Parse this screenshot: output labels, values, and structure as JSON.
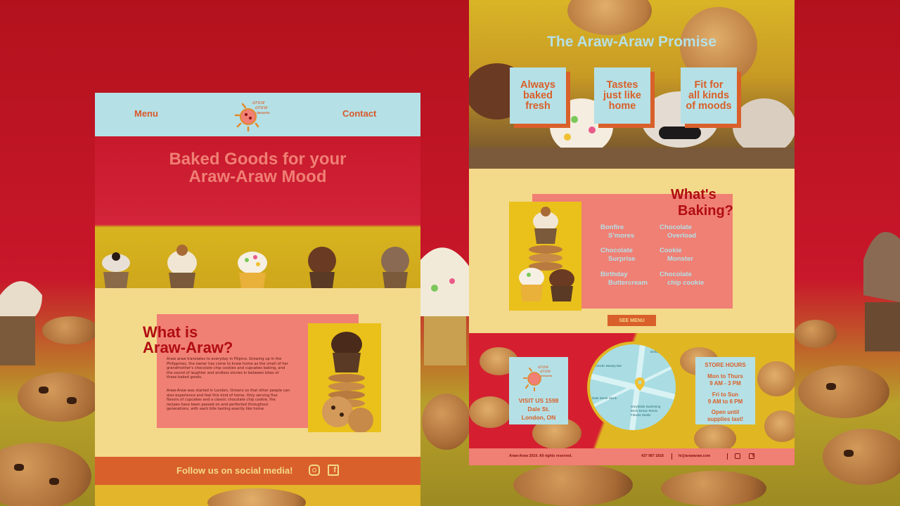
{
  "left_page": {
    "nav": {
      "menu": "Menu",
      "contact": "Contact",
      "logo_text": "araw araw desserts"
    },
    "hero_title": [
      "Baked Goods for your",
      "Araw-Araw Mood"
    ],
    "about": {
      "title": [
        "What is",
        "Araw-Araw?"
      ],
      "paragraph1": "Araw araw translates to everyday in Filipino. Growing up in the Philippines, the owner has come to know home as the smell of her grandmother's chocolate chip cookies and cupcakes baking, and the sound of laughter and endless stories in between bites of these baked goods.",
      "paragraph2": "Araw-Araw was started in London, Ontario so that other people can also experience and feel this kind of home. Only serving five flavors of cupcakes and a classic chocolate chip cookie, the recipes have been passed on and perfected throughout generations, with each bite tasting exactly like home."
    },
    "social_text": "Follow us on social media!",
    "icons": [
      "instagram-icon",
      "facebook-icon"
    ]
  },
  "right_page": {
    "promise_title": "The Araw-Araw Promise",
    "promises": [
      [
        "Always",
        "baked",
        "fresh"
      ],
      [
        "Tastes",
        "just like",
        "home"
      ],
      [
        "Fit for",
        "all kinds",
        "of moods"
      ]
    ],
    "baking_title": [
      "What's",
      "Baking?"
    ],
    "flavors": [
      [
        "Bonfire",
        "S'mores"
      ],
      [
        "Chocolate",
        "Overload"
      ],
      [
        "Chocolate",
        "Surprise"
      ],
      [
        "Cookie",
        "Monster"
      ],
      [
        "Birthday",
        "Buttercream"
      ],
      [
        "Chocolate",
        "chip cookie"
      ]
    ],
    "see_menu": "SEE MENU",
    "visit": [
      "VISIT US 1598",
      "Dale St.",
      "London, ON"
    ],
    "hours": {
      "title": "STORE HOURS",
      "weekday": [
        "Mon to Thurs",
        "9 AM - 3 PM"
      ],
      "weekend": [
        "Fri to Sun",
        "9 AM to 6 PM"
      ],
      "note": [
        "Open until",
        "supplies last!"
      ]
    },
    "map_labels": [
      "Dellorn",
      "Eclectic Beauty Bar",
      "Dale Street Stock",
      "Greyfields Swimming",
      "Brick Sense Tennis",
      "Fitness Studio"
    ],
    "footer": {
      "copyright": "Araw-Araw 2019. All rights reserved.",
      "phone": "437 987 1818",
      "email": "hi@arawaraw.com"
    }
  },
  "colors": {
    "background_red": "#c8172a",
    "light_blue": "#b5e0e6",
    "orange": "#d9602a",
    "coral": "#f07f74",
    "cream": "#f3d98a",
    "dark_red": "#b10d12",
    "yellow": "#e0b722"
  }
}
